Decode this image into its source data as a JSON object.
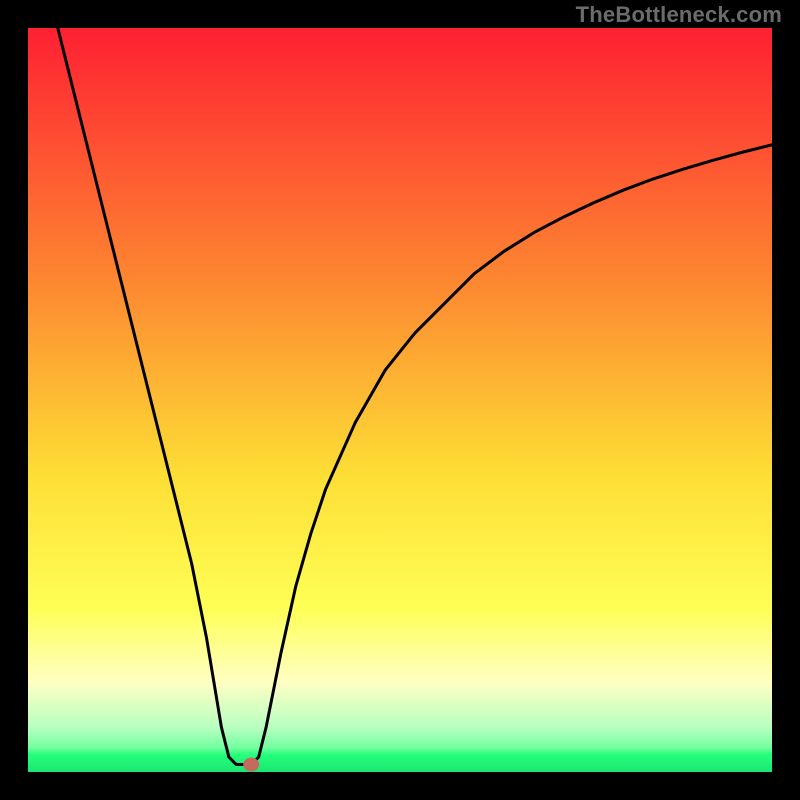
{
  "watermark": "TheBottleneck.com",
  "chart_data": {
    "type": "line",
    "title": "",
    "xlabel": "",
    "ylabel": "",
    "xlim": [
      0,
      100
    ],
    "ylim": [
      0,
      100
    ],
    "grid": false,
    "legend": false,
    "series": [
      {
        "name": "bottleneck-curve",
        "x": [
          4,
          6,
          8,
          10,
          12,
          14,
          16,
          18,
          20,
          22,
          24,
          25,
          26,
          27,
          28,
          29,
          30,
          31,
          32,
          34,
          36,
          38,
          40,
          44,
          48,
          52,
          56,
          60,
          64,
          68,
          72,
          76,
          80,
          84,
          88,
          92,
          96,
          100
        ],
        "y": [
          100,
          92,
          84,
          76,
          68,
          60,
          52,
          44,
          36,
          28,
          18,
          12,
          6,
          2,
          1,
          1,
          1,
          2,
          6,
          16,
          25,
          32,
          38,
          47,
          54,
          59,
          63,
          67,
          70,
          72.5,
          74.6,
          76.5,
          78.2,
          79.7,
          81,
          82.2,
          83.3,
          84.3
        ]
      }
    ],
    "marker": {
      "x": 30,
      "y": 1,
      "color": "#c46b5e"
    },
    "gradient_stops": [
      {
        "offset": 0,
        "color": "#fe2032"
      },
      {
        "offset": 35,
        "color": "#fd8a31"
      },
      {
        "offset": 60,
        "color": "#fdde35"
      },
      {
        "offset": 78,
        "color": "#feff56"
      },
      {
        "offset": 88,
        "color": "#ffffc4"
      },
      {
        "offset": 94,
        "color": "#b7ffc0"
      },
      {
        "offset": 100,
        "color": "#24ff7a"
      }
    ],
    "green_strip_height_pct": 3.2
  }
}
